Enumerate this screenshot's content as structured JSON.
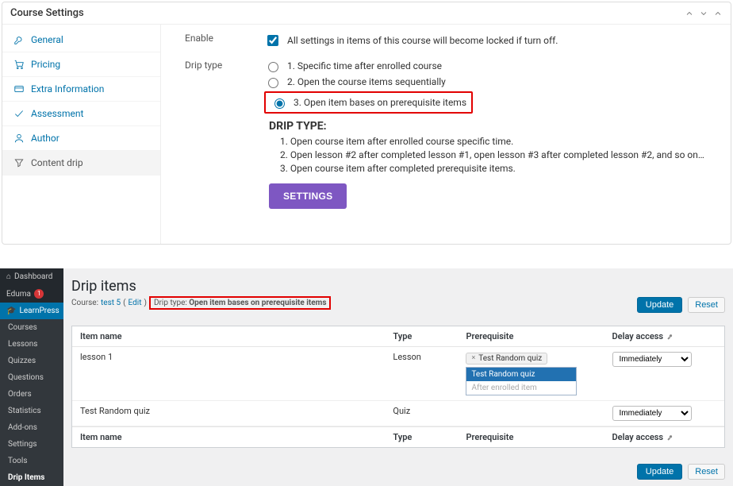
{
  "panel": {
    "title": "Course Settings",
    "sidebar": [
      {
        "label": "General"
      },
      {
        "label": "Pricing"
      },
      {
        "label": "Extra Information"
      },
      {
        "label": "Assessment"
      },
      {
        "label": "Author"
      },
      {
        "label": "Content drip"
      }
    ],
    "enable": {
      "label": "Enable",
      "text": "All settings in items of this course will become locked if turn off."
    },
    "driptype": {
      "label": "Drip type",
      "opt1": "1. Specific time after enrolled course",
      "opt2": "2. Open the course items sequentially",
      "opt3": "3. Open item bases on prerequisite items"
    },
    "desc": {
      "head": "DRIP TYPE:",
      "l1": "1. Open course item after enrolled course specific time.",
      "l2": "2. Open lesson #2 after completed lesson #1, open lesson #3 after completed lesson #2, and so on…",
      "l3": "3. Open course item after completed prerequisite items."
    },
    "settings_btn": "SETTINGS"
  },
  "wp": {
    "side": {
      "dashboard": "Dashboard",
      "eduma": "Eduma",
      "eduma_badge": "1",
      "learnpress": "LearnPress",
      "subs": [
        "Courses",
        "Lessons",
        "Quizzes",
        "Questions",
        "Orders",
        "Statistics",
        "Add-ons",
        "Settings",
        "Tools",
        "Drip Items"
      ]
    },
    "title": "Drip items",
    "course_label": "Course: ",
    "course_link": "test 5",
    "edit_link": "Edit",
    "driptype_label": "Drip type: ",
    "driptype_value": "Open item bases on prerequisite items",
    "btn_update": "Update",
    "btn_reset": "Reset",
    "cols": {
      "name": "Item name",
      "type": "Type",
      "pre": "Prerequisite",
      "delay": "Delay access"
    },
    "rows": [
      {
        "name": "lesson 1",
        "type": "Lesson",
        "tag": "Test Random quiz",
        "drop_opts": [
          "Test Random quiz",
          "After enrolled item"
        ],
        "delay": "Immediately"
      },
      {
        "name": "Test Random quiz",
        "type": "Quiz",
        "tag": "",
        "delay": "Immediately"
      }
    ]
  }
}
